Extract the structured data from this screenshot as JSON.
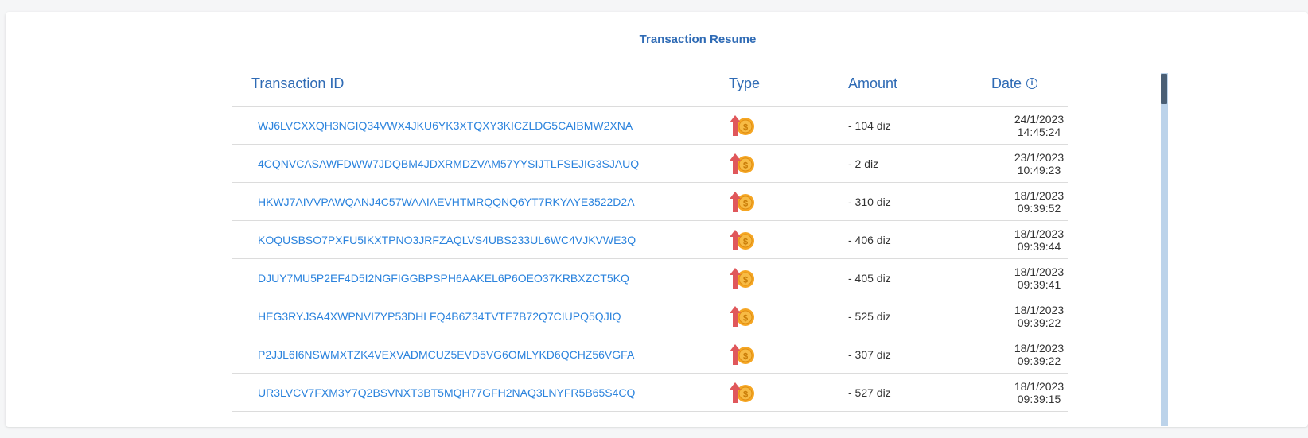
{
  "title": "Transaction Resume",
  "columns": {
    "id": "Transaction ID",
    "type": "Type",
    "amount": "Amount",
    "date": "Date"
  },
  "rows": [
    {
      "id": "WJ6LVCXXQH3NGIQ34VWX4JKU6YK3XTQXY3KICZLDG5CAIBMW2XNA",
      "type_icon": "outgoing-coin-icon",
      "amount": "- 104 diz",
      "date": "24/1/2023",
      "time": "14:45:24"
    },
    {
      "id": "4CQNVCASAWFDWW7JDQBM4JDXRMDZVAM57YYSIJTLFSEJIG3SJAUQ",
      "type_icon": "outgoing-coin-icon",
      "amount": "- 2 diz",
      "date": "23/1/2023",
      "time": "10:49:23"
    },
    {
      "id": "HKWJ7AIVVPAWQANJ4C57WAAIAEVHTMRQQNQ6YT7RKYAYE3522D2A",
      "type_icon": "outgoing-coin-icon",
      "amount": "- 310 diz",
      "date": "18/1/2023",
      "time": "09:39:52"
    },
    {
      "id": "KOQUSBSO7PXFU5IKXTPNO3JRFZAQLVS4UBS233UL6WC4VJKVWE3Q",
      "type_icon": "outgoing-coin-icon",
      "amount": "- 406 diz",
      "date": "18/1/2023",
      "time": "09:39:44"
    },
    {
      "id": "DJUY7MU5P2EF4D5I2NGFIGGBPSPH6AAKEL6P6OEO37KRBXZCT5KQ",
      "type_icon": "outgoing-coin-icon",
      "amount": "- 405 diz",
      "date": "18/1/2023",
      "time": "09:39:41"
    },
    {
      "id": "HEG3RYJSA4XWPNVI7YP53DHLFQ4B6Z34TVTE7B72Q7CIUPQ5QJIQ",
      "type_icon": "outgoing-coin-icon",
      "amount": "- 525 diz",
      "date": "18/1/2023",
      "time": "09:39:22"
    },
    {
      "id": "P2JJL6I6NSWMXTZK4VEXVADMCUZ5EVD5VG6OMLYKD6QCHZ56VGFA",
      "type_icon": "outgoing-coin-icon",
      "amount": "- 307 diz",
      "date": "18/1/2023",
      "time": "09:39:22"
    },
    {
      "id": "UR3LVCV7FXM3Y7Q2BSVNXT3BT5MQH77GFH2NAQ3LNYFR5B65S4CQ",
      "type_icon": "outgoing-coin-icon",
      "amount": "- 527 diz",
      "date": "18/1/2023",
      "time": "09:39:15"
    }
  ],
  "colors": {
    "accent": "#2f6bb5",
    "link": "#2b83dd",
    "arrow": "#e0575b",
    "coin": "#f5a623",
    "scrollbar_track": "#bcd3ea",
    "scrollbar_thumb": "#4a5f75"
  }
}
